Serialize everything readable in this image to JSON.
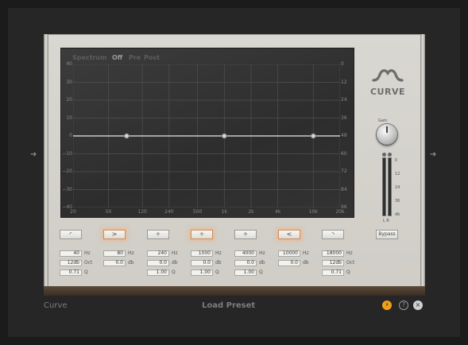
{
  "plugin": {
    "logo": "CURVE",
    "name": "Curve"
  },
  "spectrum": {
    "label": "Spectrum",
    "options": [
      "Off",
      "Pre",
      "Post"
    ],
    "selected": "Off"
  },
  "graph": {
    "left_ticks": [
      "40",
      "30",
      "20",
      "10",
      "0",
      "−10",
      "−20",
      "−30",
      "−40"
    ],
    "right_ticks": [
      "0",
      "12",
      "24",
      "36",
      "48",
      "60",
      "72",
      "84",
      "96"
    ],
    "x_ticks": [
      "20",
      "50",
      "120",
      "240",
      "500",
      "1k",
      "2k",
      "4k",
      "10k",
      "20k"
    ],
    "nodes": [
      {
        "band": 2,
        "freq_hz": 80,
        "gain_db": 0
      },
      {
        "band": 4,
        "freq_hz": 1000,
        "gain_db": 0
      },
      {
        "band": 6,
        "freq_hz": 10000,
        "gain_db": 0
      }
    ]
  },
  "gain": {
    "label": "Gain"
  },
  "meter": {
    "ticks": [
      "0",
      "12",
      "24",
      "36",
      "db"
    ],
    "channels": "L R"
  },
  "bands": [
    {
      "icon": "low-cut-icon",
      "symbol": "◜",
      "active": false,
      "freq": "40",
      "freq_unit": "Hz",
      "second": "12db",
      "second_unit": "Oct",
      "third": "0.71",
      "third_unit": "Q"
    },
    {
      "icon": "low-shelf-icon",
      "symbol": ">",
      "active": true,
      "freq": "80",
      "freq_unit": "Hz",
      "second": "0.0",
      "second_unit": "db",
      "third": "",
      "third_unit": ""
    },
    {
      "icon": "bell-icon",
      "symbol": "✧",
      "active": false,
      "freq": "240",
      "freq_unit": "Hz",
      "second": "0.0",
      "second_unit": "db",
      "third": "1.00",
      "third_unit": "Q"
    },
    {
      "icon": "bell-icon",
      "symbol": "✧",
      "active": true,
      "freq": "1000",
      "freq_unit": "Hz",
      "second": "0.0",
      "second_unit": "db",
      "third": "1.00",
      "third_unit": "Q"
    },
    {
      "icon": "bell-icon",
      "symbol": "✧",
      "active": false,
      "freq": "4000",
      "freq_unit": "Hz",
      "second": "0.0",
      "second_unit": "db",
      "third": "1.00",
      "third_unit": "Q"
    },
    {
      "icon": "high-shelf-icon",
      "symbol": "<",
      "active": true,
      "freq": "10000",
      "freq_unit": "Hz",
      "second": "0.0",
      "second_unit": "db",
      "third": "",
      "third_unit": ""
    },
    {
      "icon": "high-cut-icon",
      "symbol": "◝",
      "active": false,
      "freq": "18000",
      "freq_unit": "Hz",
      "second": "12db",
      "second_unit": "Oct",
      "third": "0.71",
      "third_unit": "Q"
    }
  ],
  "bypass": {
    "label": "Bypass"
  },
  "footer": {
    "load_preset": "Load Preset",
    "help_symbol": "?",
    "close_symbol": "×",
    "bolt_symbol": "⚡"
  },
  "colors": {
    "bolt": "#f0a21a",
    "active_glow": "#d08c5a"
  }
}
